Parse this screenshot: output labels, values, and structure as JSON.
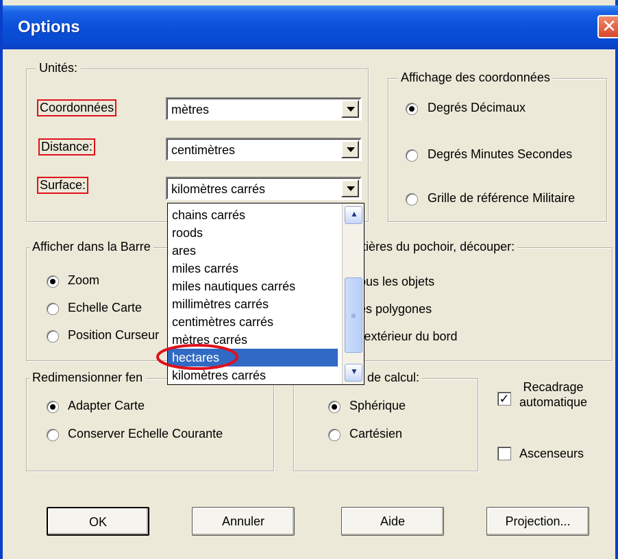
{
  "window": {
    "title": "Options",
    "close_glyph": "✕"
  },
  "units": {
    "legend": "Unités:",
    "coord_label": "Coordonnées",
    "coord_value": "mètres",
    "distance_label": "Distance:",
    "distance_value": "centimètres",
    "surface_label": "Surface:",
    "surface_value": "kilomètres carrés"
  },
  "coords_display": {
    "legend": "Affichage des coordonnées",
    "options": [
      "Degrés Décimaux",
      "Degrés Minutes Secondes",
      "Grille de référence Militaire"
    ],
    "selected": 0
  },
  "status_bar": {
    "legend": "Afficher dans la Barre",
    "options": [
      "Zoom",
      "Echelle Carte",
      "Position Curseur"
    ],
    "selected": 0
  },
  "stencil": {
    "legend": "ntières du pochoir, découper:",
    "options": [
      "ous les objets",
      "es polygones",
      "l'extérieur du bord"
    ]
  },
  "resize": {
    "legend": "Redimensionner fen",
    "options": [
      "Adapter Carte",
      "Conserver Echelle Courante"
    ],
    "selected": 0
  },
  "calc": {
    "legend": "e de calcul:",
    "options": [
      "Sphérique",
      "Cartésien"
    ],
    "selected": 0
  },
  "checks": {
    "autocrop_line1": "Recadrage",
    "autocrop_line2": "automatique",
    "autocrop_checked": true,
    "scrollbars": "Ascenseurs",
    "scrollbars_checked": false,
    "check_glyph": "✓"
  },
  "dropdown": {
    "items": [
      "chains carrés",
      "roods",
      "ares",
      "miles carrés",
      "miles nautiques carrés",
      "millimètres carrés",
      "centimètres carrés",
      "mètres carrés",
      "hectares",
      "kilomètres carrés"
    ],
    "selected_index": 8,
    "thumb_glyph": "≡"
  },
  "buttons": {
    "ok": "OK",
    "cancel": "Annuler",
    "help": "Aide",
    "projection": "Projection..."
  },
  "colors": {
    "title_bar": "#0a50d8",
    "highlight": "#316ac5",
    "annotation_red": "#e0101c",
    "dialog_bg": "#ece9d8"
  }
}
